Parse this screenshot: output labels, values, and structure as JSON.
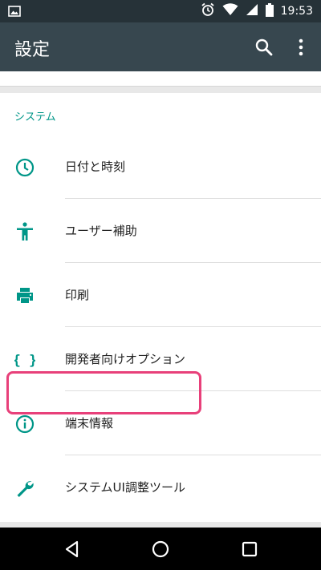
{
  "status_bar": {
    "time": "19:53",
    "icons": [
      "image-icon",
      "alarm-icon",
      "wifi-icon",
      "signal-icon",
      "battery-icon"
    ]
  },
  "toolbar": {
    "title": "設定",
    "actions": [
      "search-icon",
      "more-vert-icon"
    ]
  },
  "section": {
    "title": "システム",
    "items": [
      {
        "label": "日付と時刻",
        "icon": "clock-icon"
      },
      {
        "label": "ユーザー補助",
        "icon": "accessibility-icon"
      },
      {
        "label": "印刷",
        "icon": "print-icon"
      },
      {
        "label": "開発者向けオプション",
        "icon": "braces-icon"
      },
      {
        "label": "端末情報",
        "icon": "info-icon"
      },
      {
        "label": "システムUI調整ツール",
        "icon": "wrench-icon"
      }
    ]
  },
  "colors": {
    "status_bar": "#263238",
    "toolbar": "#37474f",
    "accent": "#009688",
    "highlight": "#e8407a"
  },
  "nav_bar": {
    "buttons": [
      "back-icon",
      "home-icon",
      "recents-icon"
    ]
  }
}
